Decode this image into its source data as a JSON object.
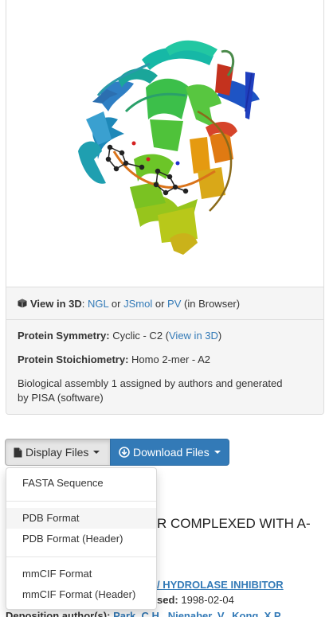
{
  "view3d": {
    "label": "View in 3D",
    "sep": ":",
    "ngl": "NGL",
    "or1": "or",
    "jsmol": "JSmol",
    "or2": "or",
    "pv": "PV",
    "suffix": "(in Browser)"
  },
  "symmetry": {
    "label": "Protein Symmetry:",
    "value": "Cyclic - C2 (",
    "link": "View in 3D",
    "close": ")"
  },
  "stoichiometry": {
    "label": "Protein Stoichiometry:",
    "value": "Homo 2-mer - A2"
  },
  "assembly_note": {
    "line1": "Biological assembly 1 assigned by authors and generated",
    "line2": "by PISA (software)"
  },
  "buttons": {
    "display": "Display Files",
    "download": "Download Files"
  },
  "dropdown": {
    "items": [
      "FASTA Sequence",
      "PDB Format",
      "PDB Format (Header)",
      "mmCIF Format",
      "mmCIF Format (Header)"
    ]
  },
  "behind": {
    "title_fragment": "R COMPLEXED WITH A-",
    "classification_fragment": "/ HYDROLASE INHIBITOR",
    "released_label": "sed:",
    "released_date": "1998-02-04",
    "authors_label": "Deposition author(s):",
    "authors_fragment": "Park, C.H., Nienaber, V., Kong, X.P."
  },
  "colors": {
    "link": "#337ab7",
    "primary_button": "#337ab7",
    "panel_footer": "#f5f5f5"
  }
}
